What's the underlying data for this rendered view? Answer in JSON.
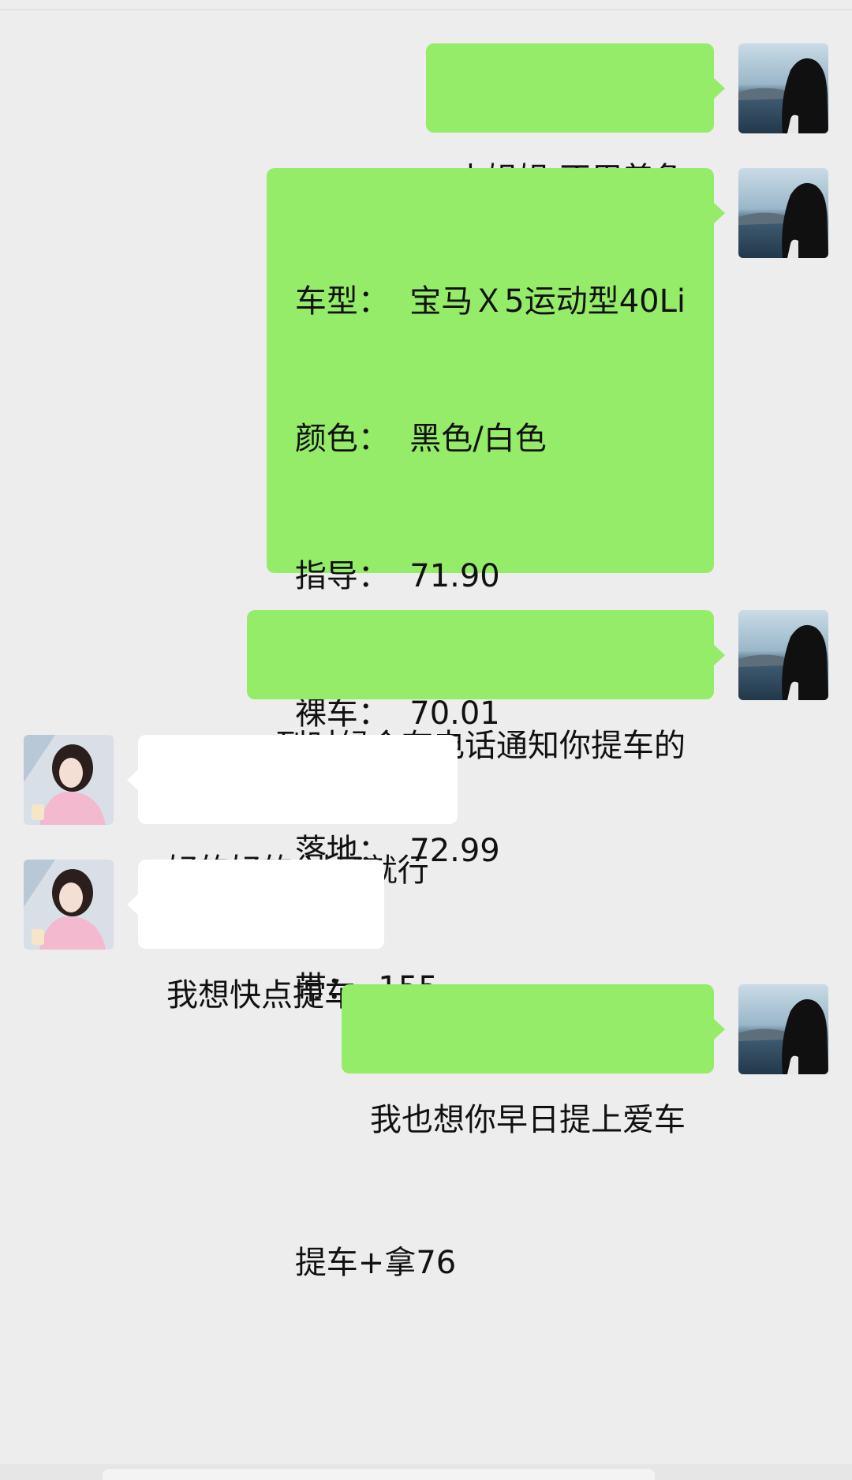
{
  "messages": [
    {
      "side": "me",
      "lines": [
        "小姐姐 不用着急"
      ]
    },
    {
      "side": "me",
      "lines": [
        "车型：  宝马Ｘ5运动型40Li",
        "颜色：  黑色/白色",
        "指导：  71.90",
        "裸车：  70.01",
        "落地：  72.99",
        "带：  155",
        "",
        "提车+拿76"
      ]
    },
    {
      "side": "me",
      "lines": [
        "到时候会有电话通知你提车的"
      ]
    },
    {
      "side": "other",
      "lines": [
        "好的好的 过了就行"
      ]
    },
    {
      "side": "other",
      "lines": [
        "我想快点提车"
      ]
    },
    {
      "side": "me",
      "lines": [
        "我也想你早日提上爱车"
      ]
    }
  ],
  "colors": {
    "background": "#ededed",
    "my_bubble": "#95ec69",
    "their_bubble": "#ffffff"
  },
  "avatars": {
    "me": "woman-by-lake-avatar",
    "other": "girl-pink-sweater-avatar"
  }
}
